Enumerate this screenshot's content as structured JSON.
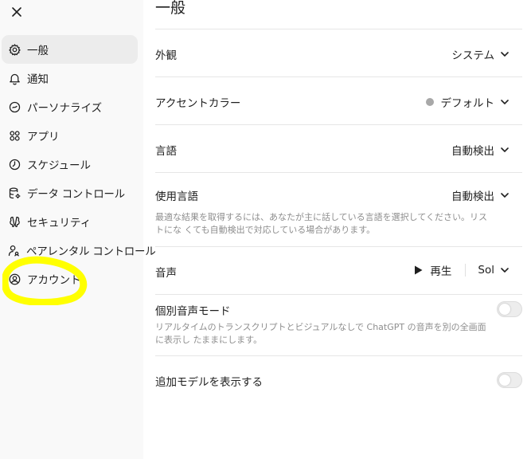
{
  "sidebar": {
    "items": [
      {
        "label": "一般",
        "icon": "gear-icon",
        "active": true
      },
      {
        "label": "通知",
        "icon": "bell-icon"
      },
      {
        "label": "パーソナライズ",
        "icon": "personalize-icon"
      },
      {
        "label": "アプリ",
        "icon": "apps-grid-icon"
      },
      {
        "label": "スケジュール",
        "icon": "clock-icon"
      },
      {
        "label": "データ コントロール",
        "icon": "database-gear-icon"
      },
      {
        "label": "セキュリティ",
        "icon": "security-icon"
      },
      {
        "label": "ペアレンタル コントロール",
        "icon": "parent-user-icon"
      },
      {
        "label": "アカウント",
        "icon": "user-circle-icon"
      }
    ],
    "highlight_color": "#ffff00"
  },
  "main": {
    "title": "一般",
    "appearance": {
      "label": "外観",
      "value": "システム"
    },
    "accent": {
      "label": "アクセントカラー",
      "value": "デフォルト",
      "dot_color": "#a8a8a8"
    },
    "language": {
      "label": "言語",
      "value": "自動検出"
    },
    "spoken_language": {
      "label": "使用言語",
      "value": "自動検出",
      "description": "最適な結果を取得するには、あなたが主に話している言語を選択してください。リストにな くても自動検出で対応している場合があります。"
    },
    "voice": {
      "label": "音声",
      "play_label": "再生",
      "value": "Sol"
    },
    "separate_voice": {
      "label": "個別音声モード",
      "description": "リアルタイムのトランスクリプトとビジュアルなしで ChatGPT の音声を別の全画面に表示し たままにします。",
      "enabled": false
    },
    "extra_models": {
      "label": "追加モデルを表示する",
      "enabled": false
    }
  }
}
